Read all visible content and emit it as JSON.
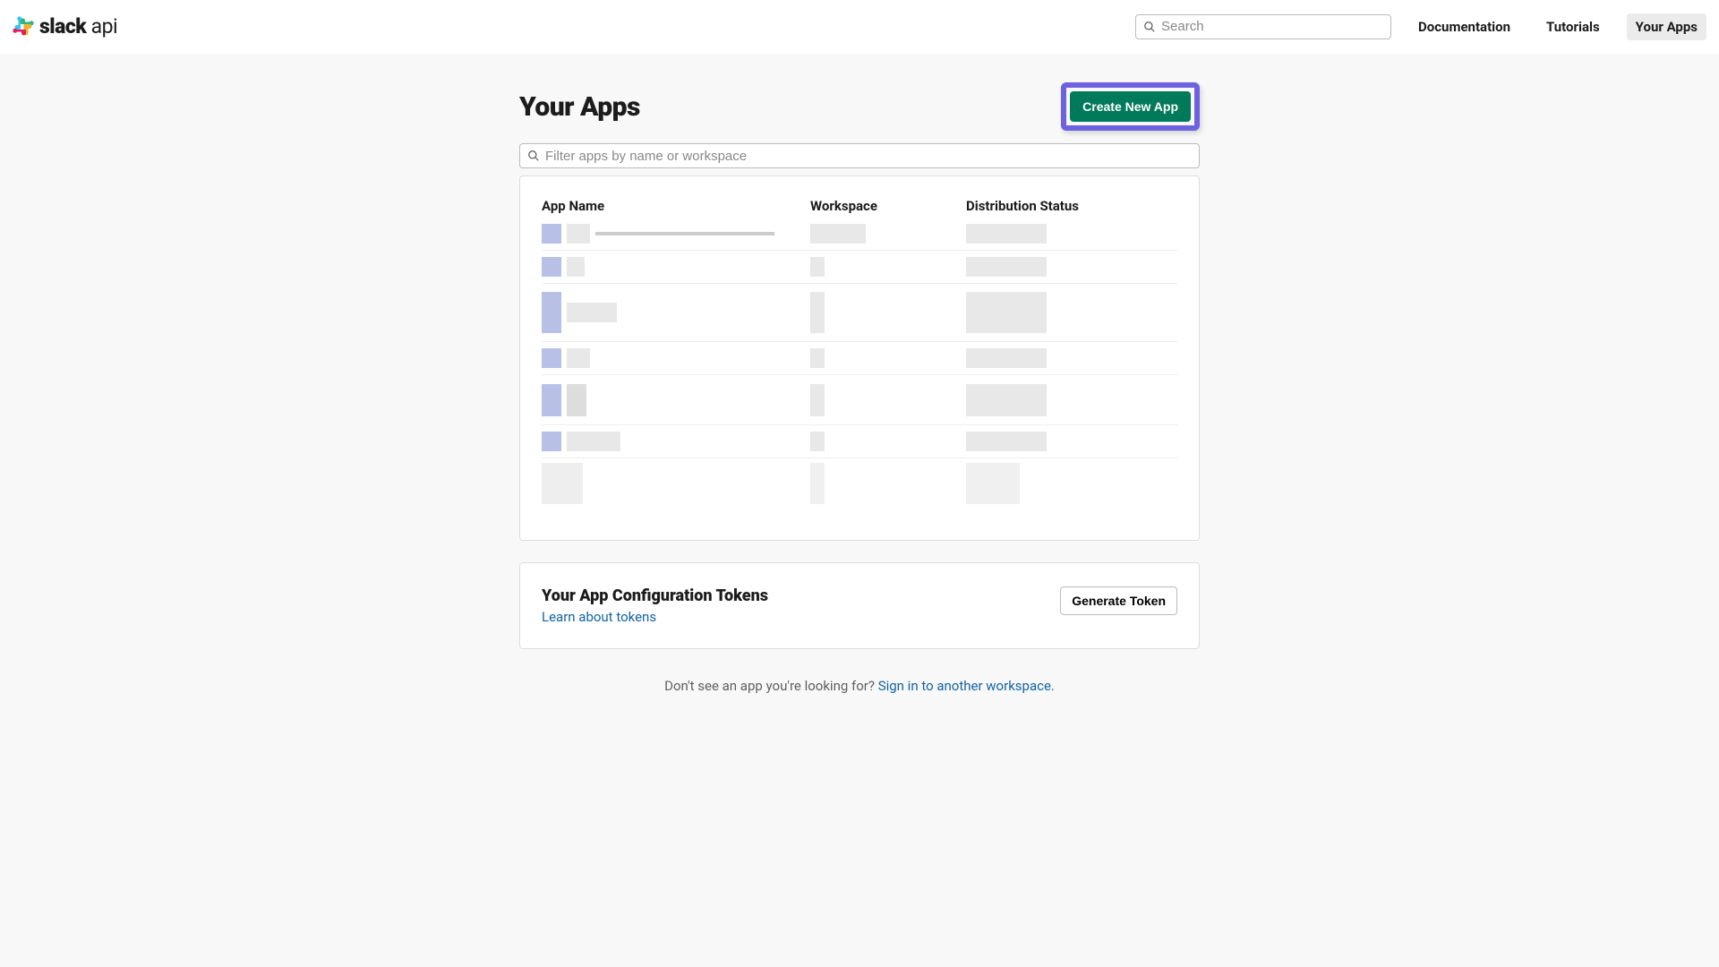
{
  "header": {
    "logo_bold": "slack",
    "logo_light": " api",
    "search_placeholder": "Search",
    "nav": {
      "documentation": "Documentation",
      "tutorials": "Tutorials",
      "your_apps": "Your Apps"
    }
  },
  "page": {
    "title": "Your Apps",
    "create_button": "Create New App",
    "filter_placeholder": "Filter apps by name or workspace",
    "columns": {
      "app_name": "App Name",
      "workspace": "Workspace",
      "distribution": "Distribution Status"
    }
  },
  "tokens": {
    "title": "Your App Configuration Tokens",
    "learn_link": "Learn about tokens",
    "generate_button": "Generate Token"
  },
  "footer": {
    "text": "Don't see an app you're looking for? ",
    "link": "Sign in to another workspace."
  }
}
